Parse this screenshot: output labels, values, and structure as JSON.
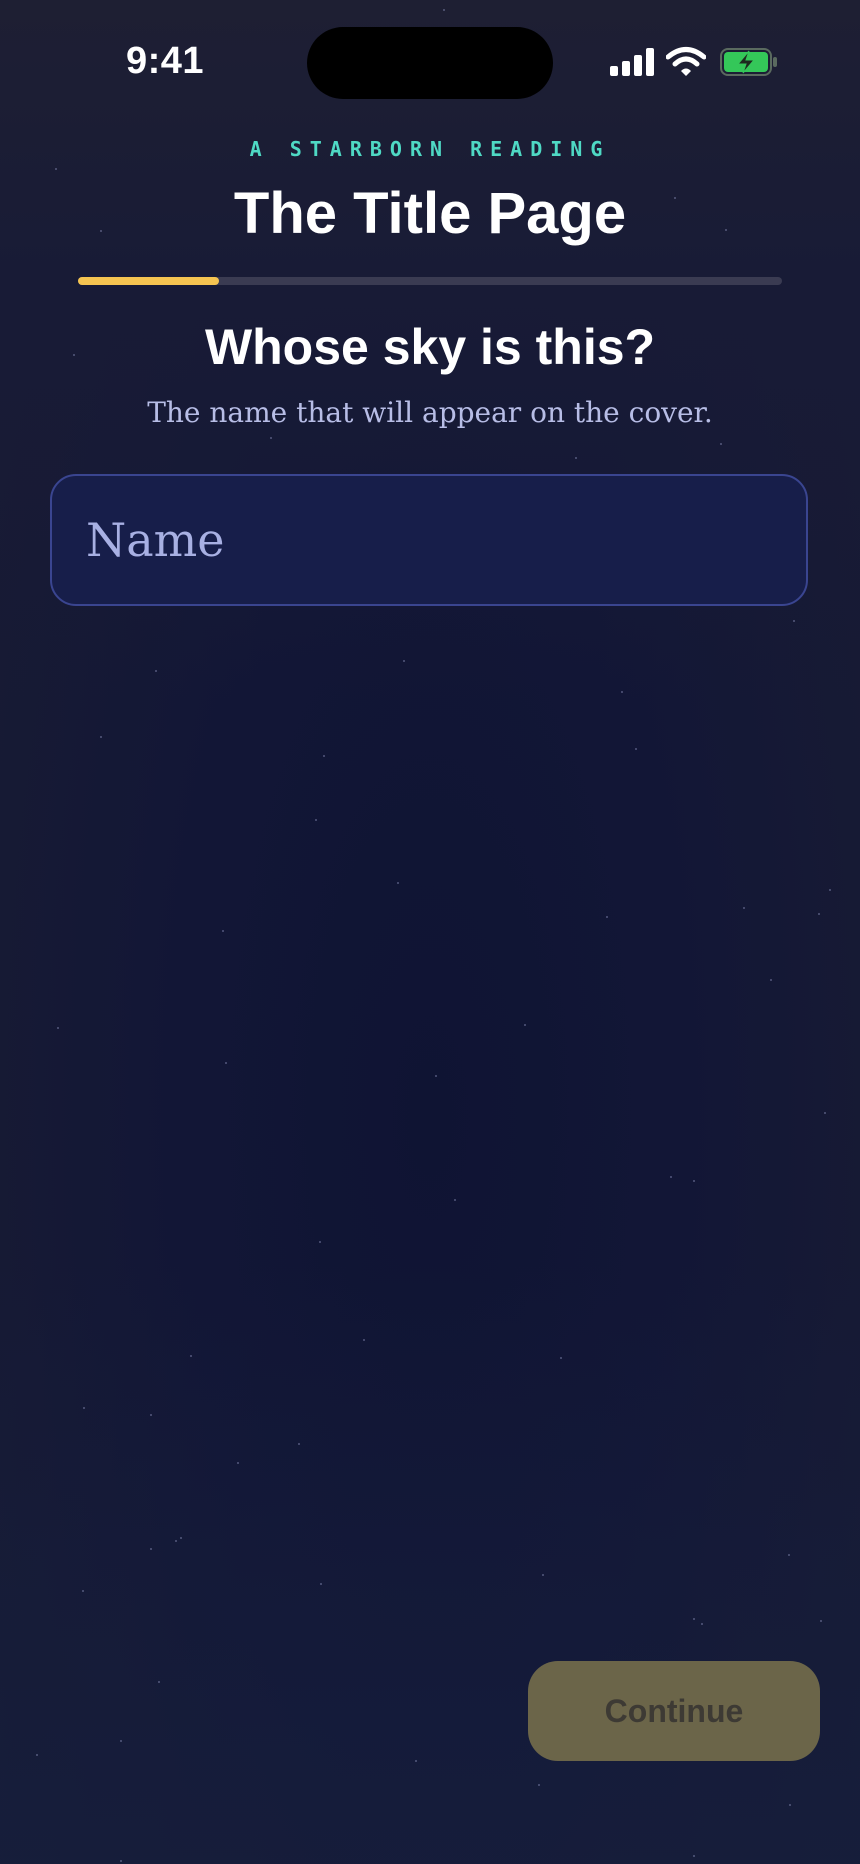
{
  "status_bar": {
    "time": "9:41",
    "signal_icon": "cellular-signal-icon",
    "wifi_icon": "wifi-icon",
    "battery_icon": "battery-charging-icon",
    "battery_color": "#34c759"
  },
  "header": {
    "eyebrow": "A STARBORN READING",
    "title": "The Title Page",
    "progress_fraction": 0.2
  },
  "prompt": {
    "question": "Whose sky is this?",
    "subtitle": "The name that will appear on the cover."
  },
  "name_field": {
    "placeholder": "Name",
    "value": ""
  },
  "footer": {
    "continue_label": "Continue",
    "continue_enabled": false
  },
  "colors": {
    "accent_teal": "#4fd9c4",
    "progress_yellow": "#f5c451",
    "button_disabled": "#6b6549"
  }
}
